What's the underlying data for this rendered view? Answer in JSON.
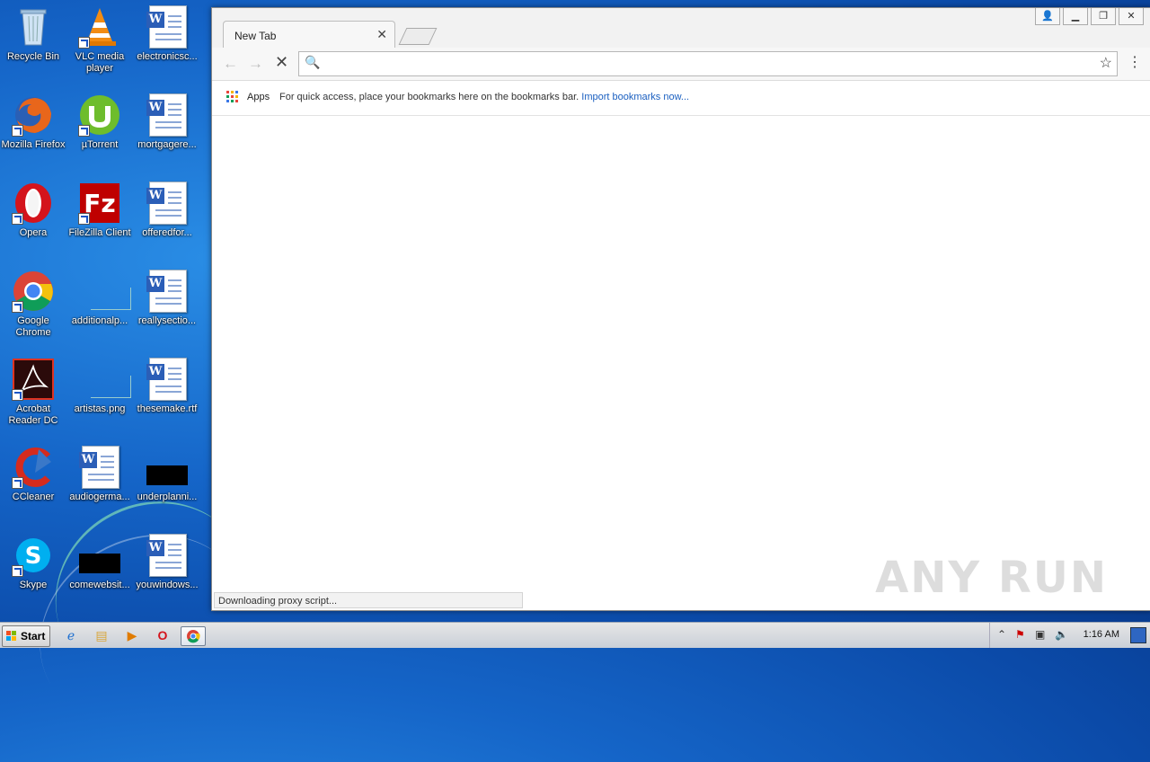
{
  "desktop": {
    "icons": [
      {
        "label": "Recycle Bin"
      },
      {
        "label": "VLC media player"
      },
      {
        "label": "electronicsc..."
      },
      {
        "label": "Mozilla Firefox"
      },
      {
        "label": "µTorrent"
      },
      {
        "label": "mortgagere..."
      },
      {
        "label": "Opera"
      },
      {
        "label": "FileZilla Client"
      },
      {
        "label": "offeredfor..."
      },
      {
        "label": "Google Chrome"
      },
      {
        "label": "additionalp..."
      },
      {
        "label": "reallysectio..."
      },
      {
        "label": "Acrobat Reader DC"
      },
      {
        "label": "artistas.png"
      },
      {
        "label": "thesemake.rtf"
      },
      {
        "label": "CCleaner"
      },
      {
        "label": "audiogerma..."
      },
      {
        "label": "underplanni..."
      },
      {
        "label": "Skype"
      },
      {
        "label": "comewebsit..."
      },
      {
        "label": "youwindows..."
      }
    ]
  },
  "browser": {
    "tab_title": "New Tab",
    "omnibox": {
      "value": "",
      "placeholder": ""
    },
    "bookmarks_bar": {
      "apps_label": "Apps",
      "message": "For quick access, place your bookmarks here on the bookmarks bar.",
      "import_link": "Import bookmarks now..."
    },
    "status_text": "Downloading proxy script...",
    "watermark": "ANY RUN"
  },
  "taskbar": {
    "start_label": "Start",
    "clock": "1:16 AM"
  },
  "colors": {
    "desktop_blue": "#1565c8",
    "link_blue": "#1a5fc0"
  }
}
